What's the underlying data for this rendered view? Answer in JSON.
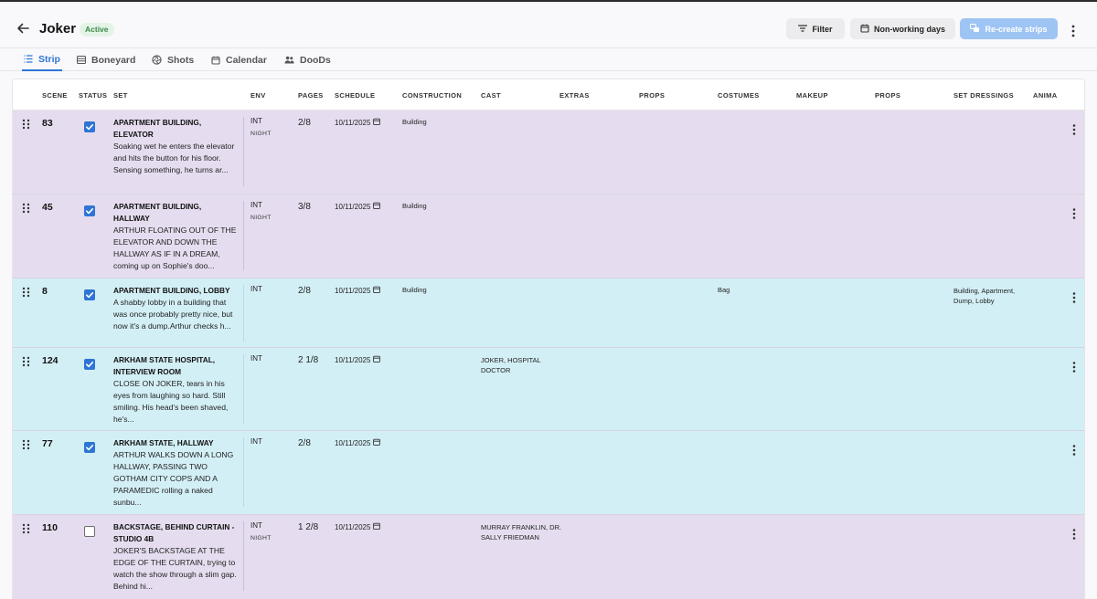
{
  "app": {
    "title": "Joker",
    "status_badge": "Active"
  },
  "header": {
    "filter_label": "Filter",
    "nonworking_label": "Non-working days",
    "recreate_label": "Re-create strips"
  },
  "tabs": [
    {
      "label": "Strip",
      "active": true,
      "icon": "list-icon"
    },
    {
      "label": "Boneyard",
      "active": false,
      "icon": "stack-icon"
    },
    {
      "label": "Shots",
      "active": false,
      "icon": "aperture-icon"
    },
    {
      "label": "Calendar",
      "active": false,
      "icon": "calendar-icon"
    },
    {
      "label": "DooDs",
      "active": false,
      "icon": "people-icon"
    }
  ],
  "columns": [
    "SCENE",
    "STATUS",
    "SET",
    "ENV",
    "PAGES",
    "SCHEDULE",
    "CONSTRUCTION",
    "CAST",
    "EXTRAS",
    "PROPS",
    "COSTUMES",
    "MAKEUP",
    "PROPS",
    "SET DRESSINGS",
    "ANIMA"
  ],
  "rows": [
    {
      "scene": "83",
      "checked": true,
      "color": "purple",
      "set_title": "APARTMENT BUILDING, ELEVATOR",
      "set_desc": "Soaking wet he enters the elevator and hits the button for his floor. Sensing something, he turns ar...",
      "env": "INT",
      "env_sub": "NIGHT",
      "pages": "2/8",
      "schedule": "10/11/2025",
      "construction": "Building",
      "cast": "",
      "costumes": "",
      "set_dressings": ""
    },
    {
      "scene": "45",
      "checked": true,
      "color": "purple",
      "set_title": "APARTMENT BUILDING, HALLWAY",
      "set_desc": "ARTHUR FLOATING OUT OF THE ELEVATOR AND DOWN THE HALLWAY AS IF IN A DREAM, coming up on Sophie's doo...",
      "env": "INT",
      "env_sub": "NIGHT",
      "pages": "3/8",
      "schedule": "10/11/2025",
      "construction": "Building",
      "cast": "",
      "costumes": "",
      "set_dressings": ""
    },
    {
      "scene": "8",
      "checked": true,
      "color": "cyan",
      "set_title": "APARTMENT BUILDING, LOBBY",
      "set_desc": "A shabby lobby in a building that was once probably pretty nice, but now it's a dump.Arthur checks h...",
      "env": "INT",
      "env_sub": "",
      "pages": "2/8",
      "schedule": "10/11/2025",
      "construction": "Building",
      "cast": "",
      "costumes": "Bag",
      "set_dressings": "Building, Apartment, Dump, Lobby"
    },
    {
      "scene": "124",
      "checked": true,
      "color": "cyan",
      "set_title": "ARKHAM STATE HOSPITAL, INTERVIEW ROOM",
      "set_desc": "CLOSE ON JOKER, tears in his eyes from laughing so hard. Still smiling. His head's been shaved, he's...",
      "env": "INT",
      "env_sub": "",
      "pages": "2 1/8",
      "schedule": "10/11/2025",
      "construction": "",
      "cast": "JOKER, HOSPITAL DOCTOR",
      "costumes": "",
      "set_dressings": ""
    },
    {
      "scene": "77",
      "checked": true,
      "color": "cyan",
      "set_title": "ARKHAM STATE, HALLWAY",
      "set_desc": "ARTHUR WALKS DOWN A LONG HALLWAY, PASSING TWO GOTHAM CITY COPS AND A PARAMEDIC rolling a naked sunbu...",
      "env": "INT",
      "env_sub": "",
      "pages": "2/8",
      "schedule": "10/11/2025",
      "construction": "",
      "cast": "",
      "costumes": "",
      "set_dressings": ""
    },
    {
      "scene": "110",
      "checked": false,
      "color": "purple",
      "set_title": "BACKSTAGE, BEHIND CURTAIN - STUDIO 4B",
      "set_desc": "JOKER'S BACKSTAGE AT THE EDGE OF THE CURTAIN, trying to watch the show through a slim gap. Behind hi...",
      "env": "INT",
      "env_sub": "NIGHT",
      "pages": "1 2/8",
      "schedule": "10/11/2025",
      "construction": "",
      "cast": "MURRAY FRANKLIN, DR. SALLY FRIEDMAN",
      "costumes": "",
      "set_dressings": ""
    }
  ]
}
